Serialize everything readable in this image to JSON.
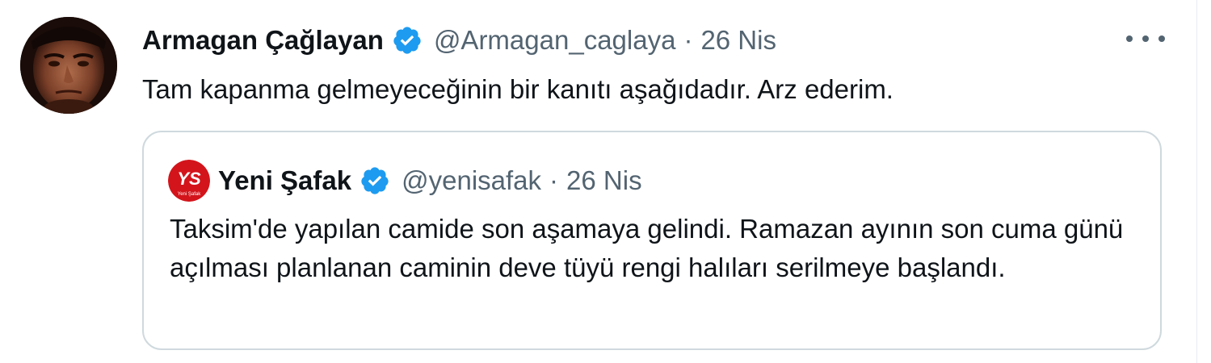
{
  "tweet": {
    "author_name": "Armagan Çağlayan",
    "handle": "@Armagan_caglaya",
    "separator": "·",
    "date": "26 Nis",
    "text": "Tam kapanma gelmeyeceğinin bir kanıtı aşağıdadır. Arz ederim.",
    "avatar_icon": "person-portrait",
    "verified_icon": "verified-badge"
  },
  "quoted_tweet": {
    "author_name": "Yeni Şafak",
    "handle": "@yenisafak",
    "separator": "·",
    "date": "26 Nis",
    "text": "Taksim'de yapılan camide son aşamaya gelindi. Ramazan ayının son cuma günü açılması planlanan caminin deve tüyü rengi halıları serilmeye başlandı.",
    "avatar_logo_text": "YS",
    "avatar_logo_subtext": "Yeni Şafak"
  },
  "colors": {
    "verified": "#1d9bf0",
    "secondary_text": "#536471",
    "border": "#cfd9de",
    "brand_red": "#d3141b"
  }
}
